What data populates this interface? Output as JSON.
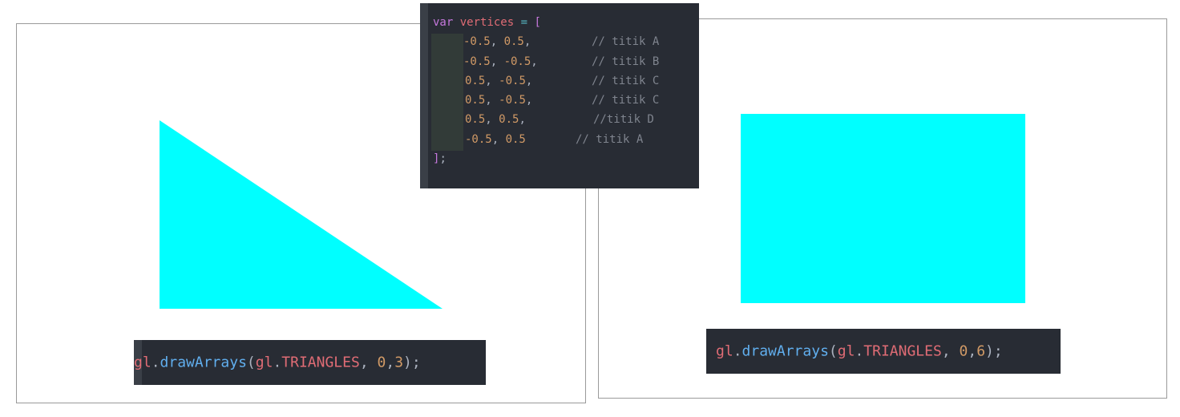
{
  "colors": {
    "shape_fill": "#00ffff",
    "code_background": "#282c34",
    "frame_border": "#9a9a9a"
  },
  "left_example": {
    "shape": "triangle",
    "call": {
      "object": "gl",
      "dot": ".",
      "method": "drawArrays",
      "open_paren": "(",
      "arg_object": "gl",
      "arg_dot": ".",
      "arg_const": "TRIANGLES",
      "comma": ", ",
      "arg_first": "0",
      "comma2": ",",
      "arg_count": "3",
      "close": ");"
    }
  },
  "right_example": {
    "shape": "rectangle",
    "call": {
      "object": "gl",
      "dot": ".",
      "method": "drawArrays",
      "open_paren": "(",
      "arg_object": "gl",
      "arg_dot": ".",
      "arg_const": "TRIANGLES",
      "comma": ", ",
      "arg_first": "0",
      "comma2": ",",
      "arg_count": "6",
      "close": ");"
    }
  },
  "vertices_code": {
    "keyword": "var",
    "name": "vertices",
    "equals": " = ",
    "open_bracket": "[",
    "close_bracket": "]",
    "semicolon": ";",
    "lines": [
      {
        "x": "-0.5",
        "y": "0.5",
        "sep": ", ",
        "trail": ",",
        "comment": "// titik A"
      },
      {
        "x": "-0.5",
        "y": "-0.5",
        "sep": ", ",
        "trail": ",",
        "comment": "// titik B"
      },
      {
        "x": "0.5",
        "y": "-0.5",
        "sep": ", ",
        "trail": ",",
        "comment": "// titik C"
      },
      {
        "x": "0.5",
        "y": "-0.5",
        "sep": ", ",
        "trail": ",",
        "comment": "// titik C"
      },
      {
        "x": "0.5",
        "y": "0.5",
        "sep": ", ",
        "trail": ",",
        "comment": "//titik D"
      },
      {
        "x": "-0.5",
        "y": "0.5",
        "sep": ", ",
        "trail": "",
        "comment": "// titik A"
      }
    ]
  }
}
